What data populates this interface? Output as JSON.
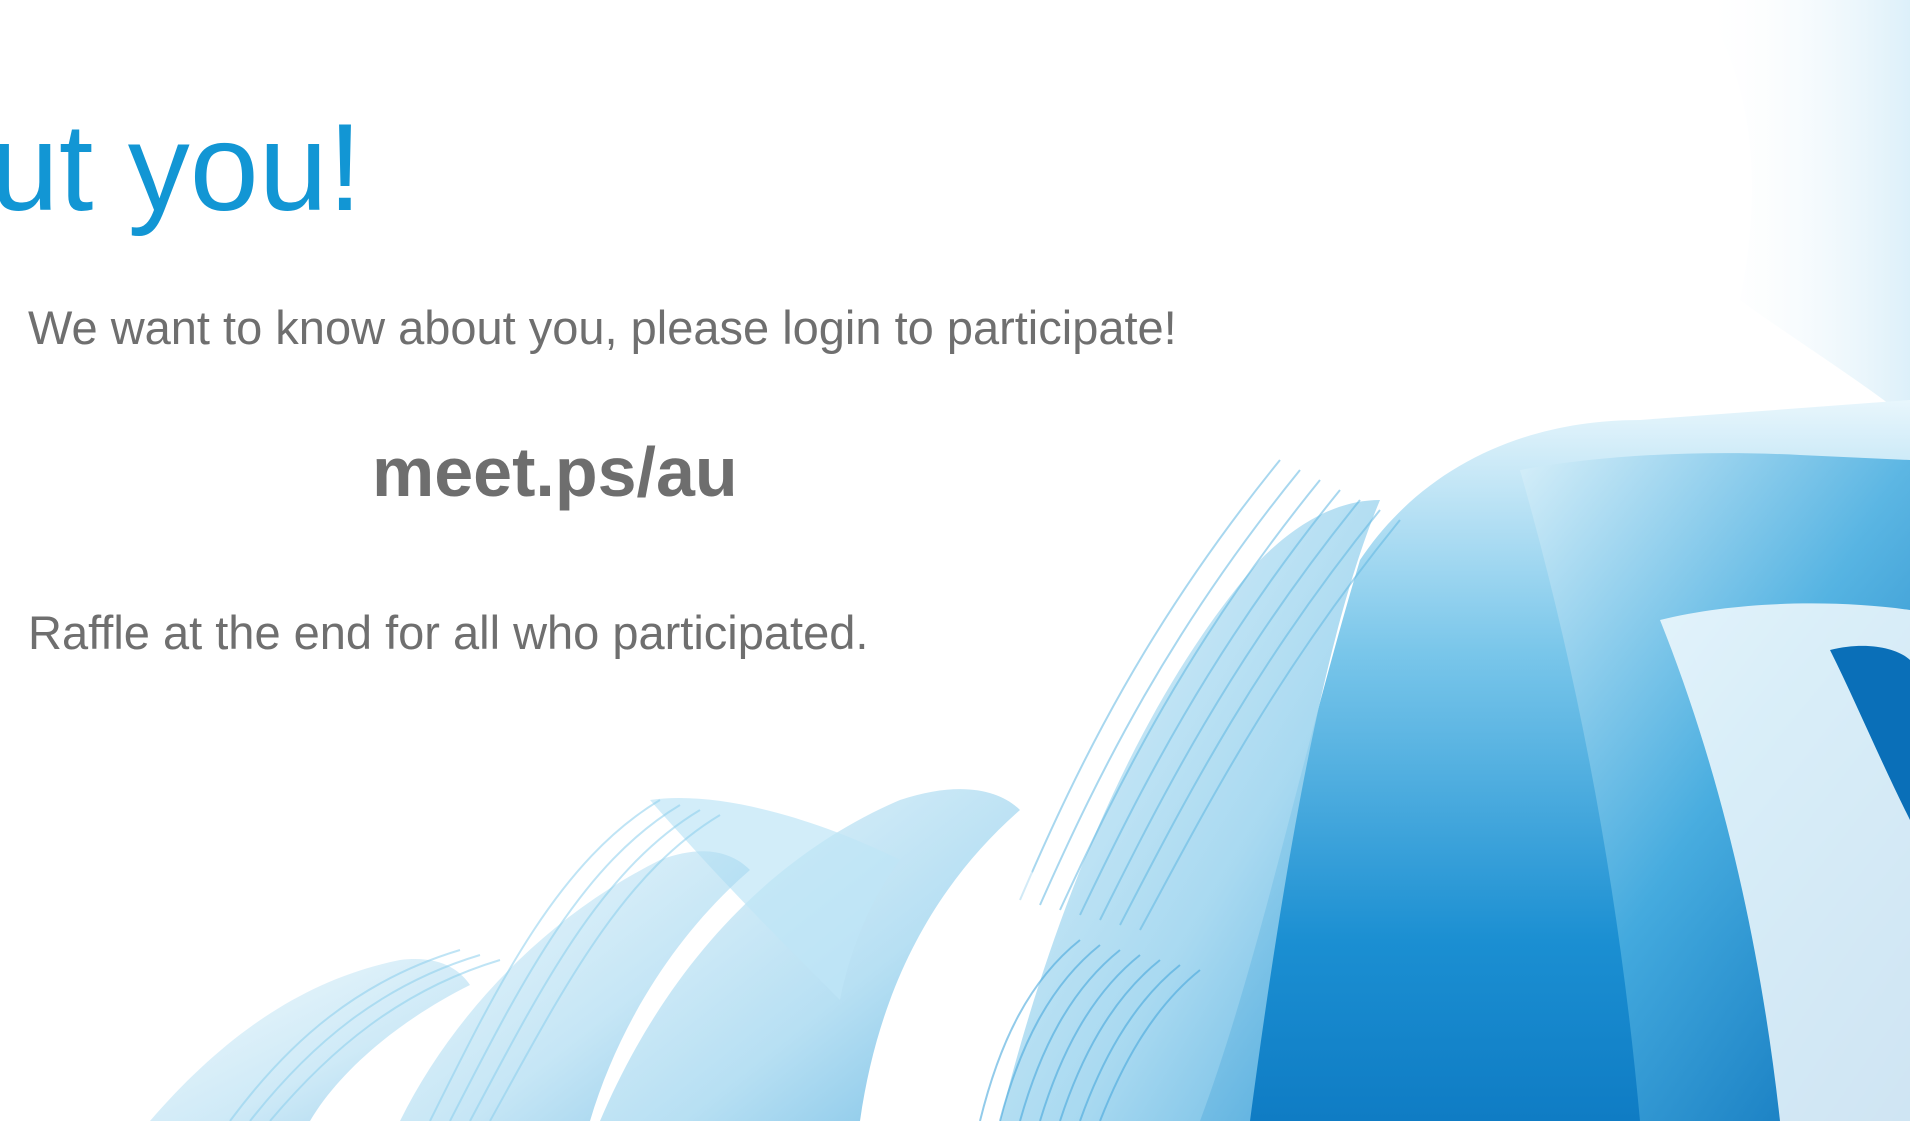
{
  "slide": {
    "title": "bout you!",
    "intro_text": "We want to know about you, please login to participate!",
    "url_text": "meet.ps/au",
    "raffle_text": "Raffle at the end for all who participated."
  },
  "colors": {
    "title": "#1296d4",
    "body_text": "#6f6f6f",
    "accent_blue": "#0b7fc7",
    "light_blue": "#bfe6f6"
  },
  "decoration": "abstract-blue-ribbon-artwork"
}
